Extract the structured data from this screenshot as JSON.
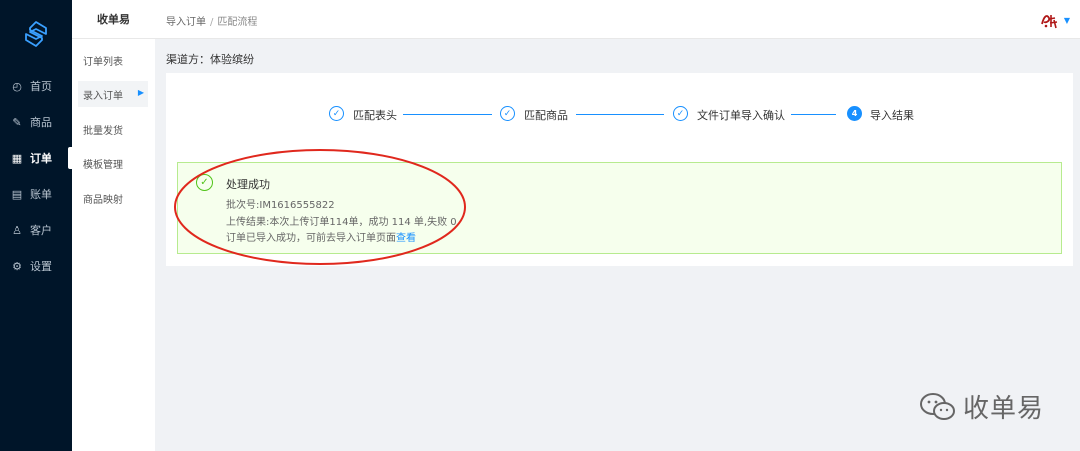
{
  "nav": {
    "items": [
      {
        "label": "首页",
        "icon": "dashboard-icon"
      },
      {
        "label": "商品",
        "icon": "edit-icon"
      },
      {
        "label": "订单",
        "icon": "table-icon",
        "active": true
      },
      {
        "label": "账单",
        "icon": "receipt-icon"
      },
      {
        "label": "客户",
        "icon": "user-icon"
      },
      {
        "label": "设置",
        "icon": "gear-icon"
      }
    ]
  },
  "sub": {
    "title": "收单易",
    "items": [
      {
        "label": "订单列表"
      },
      {
        "label": "录入订单",
        "active": true
      },
      {
        "label": "批量发货"
      },
      {
        "label": "模板管理"
      },
      {
        "label": "商品映射"
      }
    ]
  },
  "header": {
    "breadcrumb": [
      "导入订单",
      "匹配流程"
    ]
  },
  "main": {
    "channel": "渠道方：体验缤纷",
    "steps": [
      {
        "label": "匹配表头",
        "state": "done"
      },
      {
        "label": "匹配商品",
        "state": "done"
      },
      {
        "label": "文件订单导入确认",
        "state": "done"
      },
      {
        "label": "导入结果",
        "state": "current",
        "number": "4"
      }
    ],
    "result": {
      "title": "处理成功",
      "batch": "批次号:IM1616555822",
      "upload": "上传结果:本次上传订单114单，成功 114 单,失败 0",
      "note": "订单已导入成功，可前去导入订单页面",
      "link": "查看"
    }
  },
  "watermark": {
    "text": "收单易"
  },
  "colors": {
    "nav_bg": "#001529",
    "accent": "#1890ff",
    "success": "#52c41a",
    "success_bg": "#f6ffed",
    "annotation": "#e0281d"
  }
}
